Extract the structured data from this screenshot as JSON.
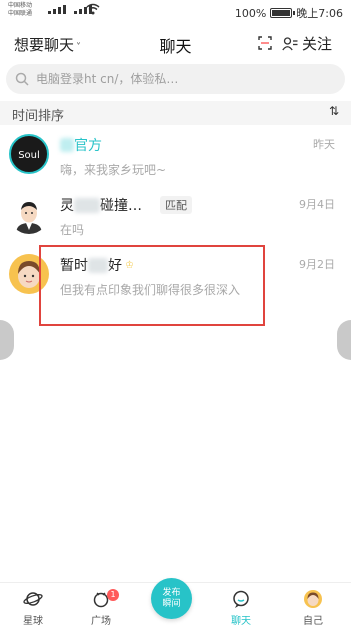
{
  "status_bar": {
    "carrier1": "中国移动",
    "carrier2": "中国联通",
    "battery_text": "100%",
    "time": "晚上7:06",
    "battery_level": 1.0
  },
  "header": {
    "left_title": "想要聊天",
    "left_chevron": "˅",
    "title": "聊天",
    "follow_label": "关注"
  },
  "search": {
    "placeholder": "电脑登录ht                          cn/，体验私…"
  },
  "sort_bar": {
    "label": "时间排序",
    "sort_icon": "⇅"
  },
  "chats": [
    {
      "name": "官方",
      "preview": "嗨，来我家乡玩吧~",
      "time": "昨天"
    },
    {
      "name_prefix": "灵",
      "name_suffix": "碰撞…",
      "tag": "匹配",
      "preview": "在吗",
      "time": "9月4日"
    },
    {
      "name_prefix": "暂时",
      "name_suffix": "好",
      "preview": "但我有点印象我们聊得很多很深入",
      "time": "9月2日"
    }
  ],
  "tabbar": {
    "tabs": [
      {
        "label": "星球",
        "icon": "planet-icon"
      },
      {
        "label": "广场",
        "icon": "square-icon",
        "badge": "1"
      },
      {
        "label": "聊天",
        "icon": "chat-icon"
      },
      {
        "label": "自己",
        "icon": "avatar-icon"
      }
    ],
    "publish_line1": "发布",
    "publish_line2": "瞬间"
  },
  "colors": {
    "accent": "#27c3c8",
    "highlight_box": "#e0443e",
    "badge": "#ff5a5a"
  }
}
